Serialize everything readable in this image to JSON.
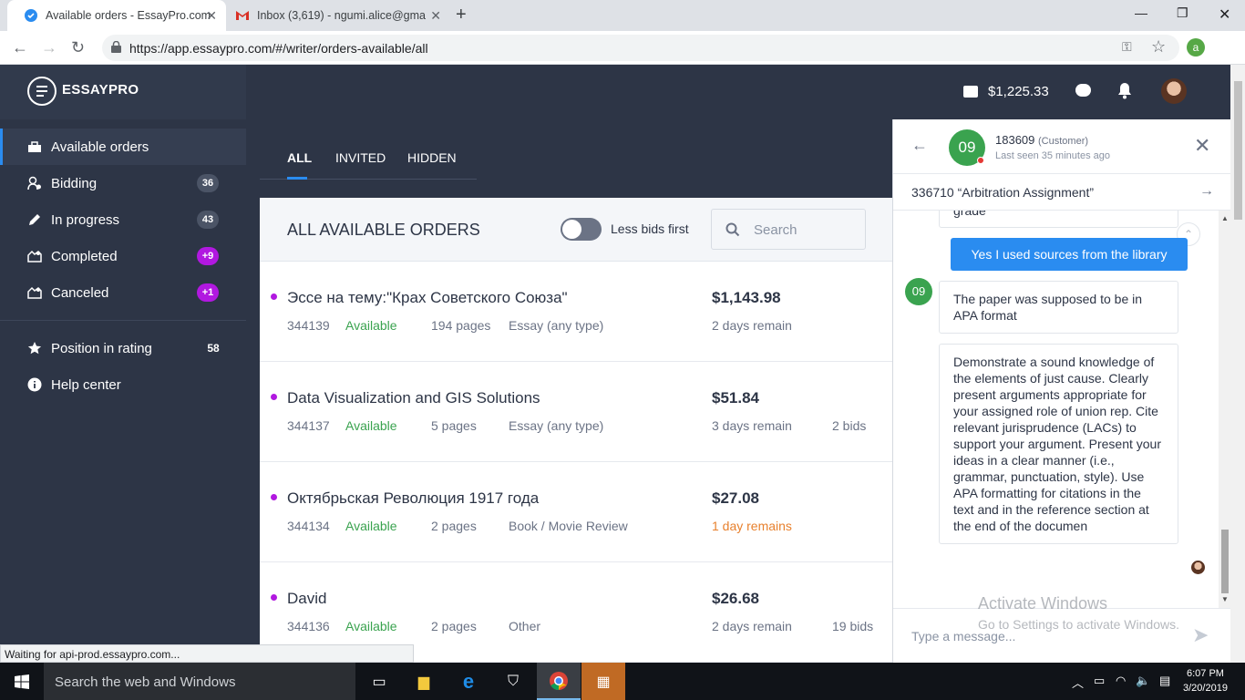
{
  "browser": {
    "tabs": [
      {
        "title": "Available orders - EssayPro.com"
      },
      {
        "title": "Inbox (3,619) - ngumi.alice@gma"
      }
    ],
    "url": "https://app.essaypro.com/#/writer/orders-available/all",
    "profile_initial": "a",
    "status_text": "Waiting for api-prod.essaypro.com..."
  },
  "app": {
    "logo_prefix": "ESSAY",
    "logo_suffix": "PRO",
    "balance": "$1,225.33"
  },
  "sidebar": {
    "items": [
      {
        "label": "Available orders",
        "badge": ""
      },
      {
        "label": "Bidding",
        "badge": "36"
      },
      {
        "label": "In progress",
        "badge": "43"
      },
      {
        "label": "Completed",
        "badge": "+9"
      },
      {
        "label": "Canceled",
        "badge": "+1"
      },
      {
        "label": "Position in rating",
        "badge": "58"
      },
      {
        "label": "Help center",
        "badge": ""
      }
    ]
  },
  "main": {
    "tabs": [
      "ALL",
      "INVITED",
      "HIDDEN"
    ],
    "panel_title": "ALL AVAILABLE ORDERS",
    "toggle_label": "Less bids first",
    "search_placeholder": "Search",
    "orders": [
      {
        "title": "Эссе на тему:\"Крах Советского Союза\"",
        "id": "344139",
        "status": "Available",
        "pages": "194 pages",
        "type": "Essay (any type)",
        "price": "$1,143.98",
        "remain": "2 days remain",
        "bids": ""
      },
      {
        "title": "Data Visualization and GIS Solutions",
        "id": "344137",
        "status": "Available",
        "pages": "5 pages",
        "type": "Essay (any type)",
        "price": "$51.84",
        "remain": "3 days remain",
        "bids": "2 bids"
      },
      {
        "title": "Октябрьская Революция 1917 года",
        "id": "344134",
        "status": "Available",
        "pages": "2 pages",
        "type": "Book / Movie Review",
        "price": "$27.08",
        "remain": "1 day remains",
        "bids": ""
      },
      {
        "title": "David",
        "id": "344136",
        "status": "Available",
        "pages": "2 pages",
        "type": "Other",
        "price": "$26.68",
        "remain": "2 days remain",
        "bids": "19 bids"
      }
    ]
  },
  "chat": {
    "avatar": "09",
    "user": "183609",
    "role": "(Customer)",
    "last_seen": "Last seen 35 minutes ago",
    "order": "336710 “Arbitration Assignment”",
    "partial_msg": "grade",
    "my_msg": "Yes I used sources from the library",
    "msg1": "The paper was supposed to be in APA format",
    "msg2": "Demonstrate a sound knowledge of the elements of just cause. Clearly present arguments appropriate for your assigned role of union rep. Cite relevant jurisprudence (LACs) to support your argument. Present your ideas in a clear manner (i.e., grammar, punctuation, style). Use APA formatting for citations in the text and in the reference section at the end of the documen",
    "compose_placeholder": "Type a message..."
  },
  "watermark": {
    "line1": "Activate Windows",
    "line2": "Go to Settings to activate Windows."
  },
  "taskbar": {
    "search": "Search the web and Windows",
    "time": "6:07 PM",
    "date": "3/20/2019"
  }
}
